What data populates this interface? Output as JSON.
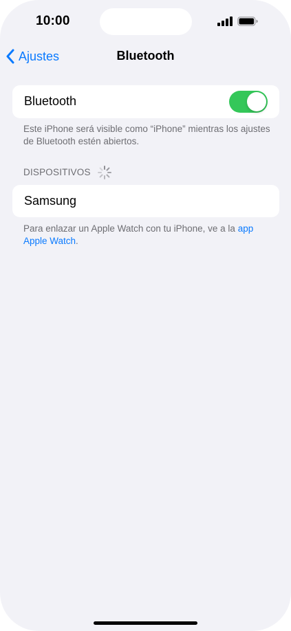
{
  "status_bar": {
    "time": "10:00",
    "signal_icon": "cellular-signal-icon",
    "battery_icon": "battery-icon"
  },
  "nav": {
    "back_label": "Ajustes",
    "back_icon": "chevron-left-icon",
    "title": "Bluetooth"
  },
  "bluetooth_group": {
    "label": "Bluetooth",
    "toggle_on": true,
    "footer": "Este iPhone será visible como “iPhone” mientras los ajustes de Bluetooth estén abiertos."
  },
  "devices": {
    "header": "DISPOSITIVOS",
    "spinner_icon": "loading-spinner-icon",
    "items": [
      {
        "name": "Samsung"
      }
    ],
    "footer_text": "Para enlazar un Apple Watch con tu iPhone, ve a la",
    "footer_link": "app Apple Watch",
    "footer_end": "."
  },
  "colors": {
    "accent": "#0a7aff",
    "toggle_on": "#34c759",
    "background": "#f2f2f7",
    "secondary_text": "#6d6d72"
  }
}
